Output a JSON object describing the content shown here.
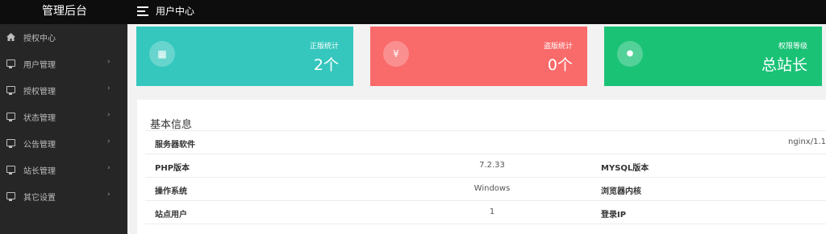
{
  "header": {
    "brand": "管理后台",
    "page_title": "用户中心"
  },
  "sidebar": {
    "items": [
      {
        "label": "授权中心",
        "icon": "home-icon",
        "submenu": false
      },
      {
        "label": "用户管理",
        "icon": "monitor-icon",
        "submenu": true
      },
      {
        "label": "授权管理",
        "icon": "monitor-icon",
        "submenu": true
      },
      {
        "label": "状态管理",
        "icon": "monitor-icon",
        "submenu": true
      },
      {
        "label": "公告管理",
        "icon": "monitor-icon",
        "submenu": true
      },
      {
        "label": "站长管理",
        "icon": "monitor-icon",
        "submenu": true
      },
      {
        "label": "其它设置",
        "icon": "monitor-icon",
        "submenu": true
      }
    ],
    "chevron": "›"
  },
  "cards": [
    {
      "title": "正版统计",
      "value": "2个",
      "icon": "document-icon",
      "glyph": "▦",
      "color": "#35c7bd"
    },
    {
      "title": "盗版统计",
      "value": "0个",
      "icon": "yen-icon",
      "glyph": "¥",
      "color": "#f96a6a"
    },
    {
      "title": "权限等级",
      "value": "总站长",
      "icon": "user-circle-icon",
      "glyph": "●",
      "color": "#1ac276"
    }
  ],
  "info": {
    "title": "基本信息",
    "server_software_label": "服务器软件",
    "server_software_value": "nginx/1.1",
    "rows": [
      {
        "label": "PHP版本",
        "value": "7.2.33",
        "label2": "MYSQL版本"
      },
      {
        "label": "操作系统",
        "value": "Windows",
        "label2": "浏览器内核"
      },
      {
        "label": "站点用户",
        "value": "1",
        "label2": "登录IP"
      }
    ]
  }
}
